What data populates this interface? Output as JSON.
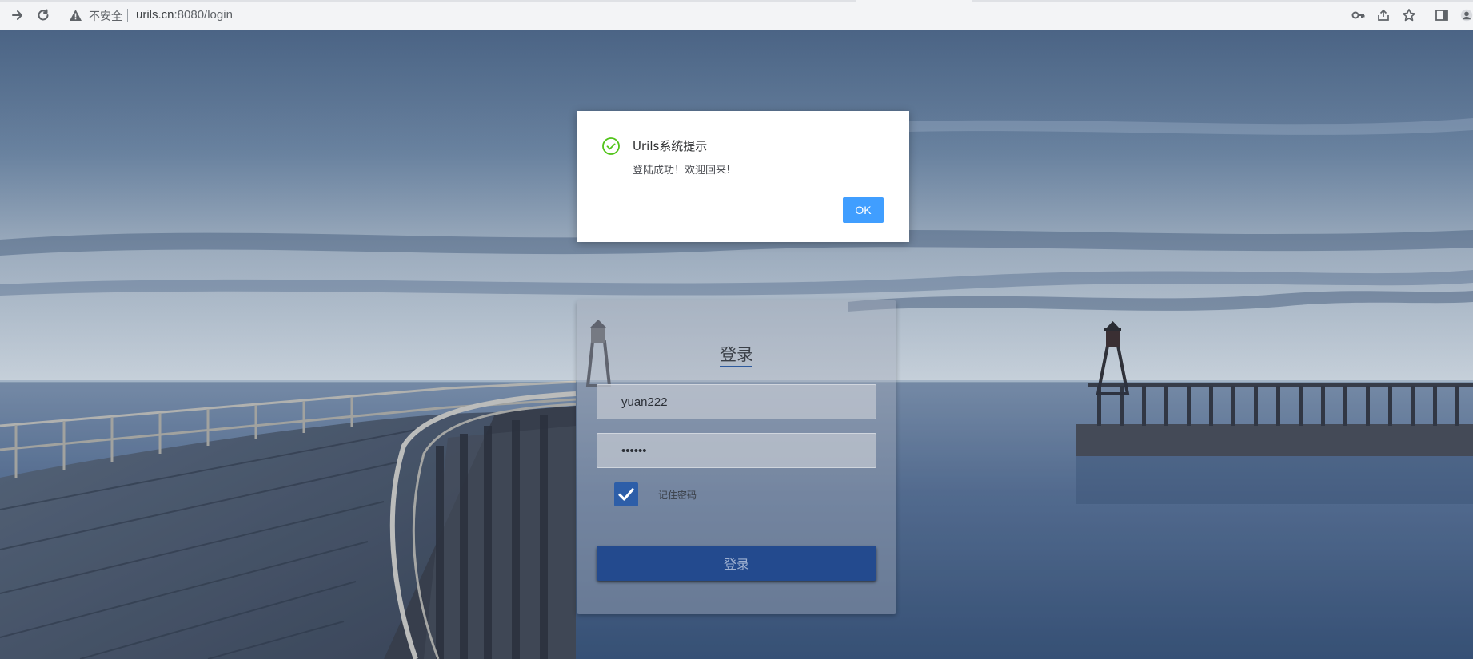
{
  "browser": {
    "insecure_label": "不安全",
    "url_host": "urils.cn",
    "url_path": ":8080/login"
  },
  "login": {
    "title": "登录",
    "username_value": "yuan222",
    "password_value": "••••••",
    "remember_label": "记住密码",
    "remember_checked": true,
    "submit_label": "登录"
  },
  "dialog": {
    "title": "Urils系统提示",
    "message": "登陆成功！欢迎回来!",
    "ok_label": "OK",
    "icon": "success-check-icon",
    "icon_color": "#52c41a"
  },
  "colors": {
    "ok_button": "#409eff",
    "login_button": "#234a8e",
    "checkbox": "#2d5ea8"
  }
}
